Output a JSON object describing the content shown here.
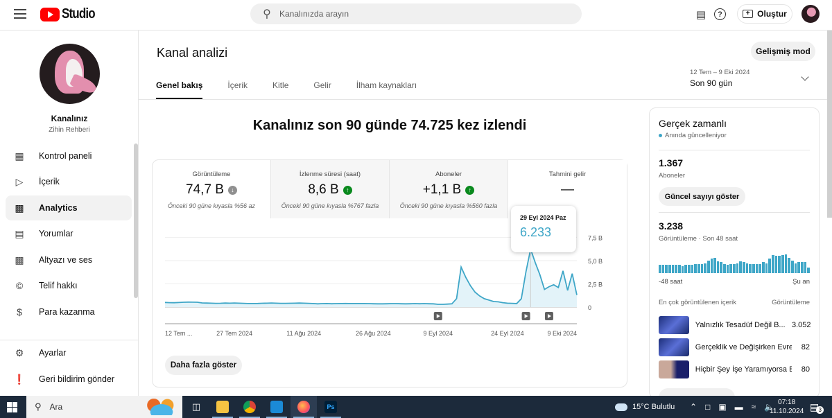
{
  "topbar": {
    "app_name": "Studio",
    "search_placeholder": "Kanalınızda arayın",
    "create_label": "Oluştur"
  },
  "sidebar": {
    "channel_label": "Kanalınız",
    "channel_name": "Zihin Rehberi",
    "items": [
      {
        "label": "Kontrol paneli",
        "icon": "dashboard-icon"
      },
      {
        "label": "İçerik",
        "icon": "content-icon"
      },
      {
        "label": "Analytics",
        "icon": "analytics-icon",
        "active": true
      },
      {
        "label": "Yorumlar",
        "icon": "comments-icon"
      },
      {
        "label": "Altyazı ve ses",
        "icon": "subtitles-icon"
      },
      {
        "label": "Telif hakkı",
        "icon": "copyright-icon"
      },
      {
        "label": "Para kazanma",
        "icon": "dollar-icon"
      }
    ],
    "bottom_items": [
      {
        "label": "Ayarlar",
        "icon": "gear-icon"
      },
      {
        "label": "Geri bildirim gönder",
        "icon": "feedback-icon"
      }
    ]
  },
  "main": {
    "title": "Kanal analizi",
    "advanced_mode_label": "Gelişmiş mod",
    "tabs": [
      {
        "label": "Genel bakış",
        "active": true
      },
      {
        "label": "İçerik"
      },
      {
        "label": "Kitle"
      },
      {
        "label": "Gelir"
      },
      {
        "label": "İlham kaynakları"
      }
    ],
    "date_range": {
      "dates": "12 Tem – 9 Eki 2024",
      "label": "Son 90 gün"
    },
    "headline": "Kanalınız son 90 günde 74.725 kez izlendi",
    "metrics": [
      {
        "title": "Görüntüleme",
        "value": "74,7 B",
        "trend": "down",
        "comparison": "Önceki 90 güne kıyasla %56 az"
      },
      {
        "title": "İzlenme süresi (saat)",
        "value": "8,6 B",
        "trend": "up",
        "comparison": "Önceki 90 güne kıyasla %767 fazla"
      },
      {
        "title": "Aboneler",
        "value": "+1,1 B",
        "trend": "up",
        "comparison": "Önceki 90 güne kıyasla %560 fazla"
      },
      {
        "title": "Tahmini gelir",
        "value": "—",
        "trend": "none",
        "comparison": ""
      }
    ],
    "tooltip": {
      "date": "29 Eyl 2024 Paz",
      "value": "6.233"
    },
    "show_more_label": "Daha fazla göster"
  },
  "chart_data": {
    "type": "area",
    "title": "Görüntüleme",
    "y_tick_labels": [
      "0",
      "2,5 B",
      "5,0 B",
      "7,5 B"
    ],
    "ylim": [
      0,
      8500
    ],
    "x_tick_labels": [
      "12 Tem ...",
      "27 Tem 2024",
      "11 Ağu 2024",
      "26 Ağu 2024",
      "9 Eyl 2024",
      "24 Eyl 2024",
      "9 Eki 2024"
    ],
    "x": [
      "12 Tem",
      "13 Tem",
      "14 Tem",
      "15 Tem",
      "16 Tem",
      "17 Tem",
      "18 Tem",
      "19 Tem",
      "20 Tem",
      "21 Tem",
      "22 Tem",
      "23 Tem",
      "24 Tem",
      "25 Tem",
      "26 Tem",
      "27 Tem",
      "28 Tem",
      "29 Tem",
      "30 Tem",
      "31 Tem",
      "1 Ağu",
      "2 Ağu",
      "3 Ağu",
      "4 Ağu",
      "5 Ağu",
      "6 Ağu",
      "7 Ağu",
      "8 Ağu",
      "9 Ağu",
      "10 Ağu",
      "11 Ağu",
      "12 Ağu",
      "13 Ağu",
      "14 Ağu",
      "15 Ağu",
      "16 Ağu",
      "17 Ağu",
      "18 Ağu",
      "19 Ağu",
      "20 Ağu",
      "21 Ağu",
      "22 Ağu",
      "23 Ağu",
      "24 Ağu",
      "25 Ağu",
      "26 Ağu",
      "27 Ağu",
      "28 Ağu",
      "29 Ağu",
      "30 Ağu",
      "31 Ağu",
      "1 Eyl",
      "2 Eyl",
      "3 Eyl",
      "4 Eyl",
      "5 Eyl",
      "6 Eyl",
      "7 Eyl",
      "8 Eyl",
      "9 Eyl",
      "10 Eyl",
      "11 Eyl",
      "12 Eyl",
      "13 Eyl",
      "14 Eyl",
      "15 Eyl",
      "16 Eyl",
      "17 Eyl",
      "18 Eyl",
      "19 Eyl",
      "20 Eyl",
      "21 Eyl",
      "22 Eyl",
      "23 Eyl",
      "24 Eyl",
      "25 Eyl",
      "26 Eyl",
      "27 Eyl",
      "28 Eyl",
      "29 Eyl",
      "30 Eyl",
      "1 Eki",
      "2 Eki",
      "3 Eki",
      "4 Eki",
      "5 Eki",
      "6 Eki",
      "7 Eki",
      "8 Eki",
      "9 Eki"
    ],
    "series": [
      {
        "name": "Görüntüleme",
        "values": [
          500,
          480,
          470,
          490,
          520,
          540,
          530,
          520,
          450,
          430,
          420,
          400,
          410,
          430,
          420,
          440,
          420,
          400,
          380,
          380,
          390,
          410,
          420,
          440,
          420,
          400,
          400,
          410,
          420,
          430,
          420,
          400,
          380,
          350,
          370,
          380,
          360,
          370,
          380,
          390,
          380,
          380,
          380,
          380,
          370,
          360,
          350,
          350,
          360,
          370,
          370,
          360,
          350,
          360,
          370,
          360,
          370,
          360,
          350,
          300,
          300,
          320,
          350,
          900,
          4300,
          3200,
          2300,
          1600,
          1200,
          900,
          750,
          600,
          570,
          480,
          420,
          400,
          380,
          900,
          3800,
          6233,
          4800,
          3500,
          1900,
          2200,
          2400,
          2100,
          3900,
          1800,
          3600,
          1300
        ]
      }
    ],
    "markers_at": [
      "9 Eyl 2024",
      "28 Eyl 2024",
      "3 Eki 2024"
    ],
    "highlight": {
      "x": "29 Eyl 2024",
      "value": 6233
    }
  },
  "realtime": {
    "title": "Gerçek zamanlı",
    "live_label": "Anında güncelleniyor",
    "subscribers_value": "1.367",
    "subscribers_label": "Aboneler",
    "show_count_label": "Güncel sayıyı göster",
    "views_value": "3.238",
    "views_label": "Görüntüleme · Son 48 saat",
    "hourly_views_relative": [
      0.45,
      0.45,
      0.45,
      0.45,
      0.45,
      0.45,
      0.45,
      0.4,
      0.45,
      0.45,
      0.45,
      0.5,
      0.5,
      0.5,
      0.55,
      0.7,
      0.8,
      0.85,
      0.65,
      0.6,
      0.5,
      0.45,
      0.5,
      0.5,
      0.55,
      0.65,
      0.6,
      0.55,
      0.5,
      0.5,
      0.5,
      0.5,
      0.6,
      0.55,
      0.8,
      1.0,
      0.95,
      0.95,
      1.0,
      1.05,
      0.85,
      0.7,
      0.55,
      0.6,
      0.6,
      0.6,
      0.3
    ],
    "axis_start": "-48 saat",
    "axis_end": "Şu an",
    "top_content_header": "En çok görüntülenen içerik",
    "top_content_metric": "Görüntüleme",
    "top_content": [
      {
        "title": "Yalnızlık Tesadüf Değil B...",
        "views": "3.052"
      },
      {
        "title": "Gerçeklik ve Değişirken Evre...",
        "views": "82"
      },
      {
        "title": "Hiçbir Şey İşe Yaramıyorsa E...",
        "views": "80"
      }
    ]
  },
  "taskbar": {
    "search_label": "Ara",
    "weather": "15°C  Bulutlu",
    "time": "07:18",
    "date": "11.10.2024",
    "notifications_count": "3"
  },
  "colors": {
    "accent": "#3ea6c7",
    "up": "#0a8a1e",
    "down": "#909090",
    "brand": "#ff0000"
  }
}
